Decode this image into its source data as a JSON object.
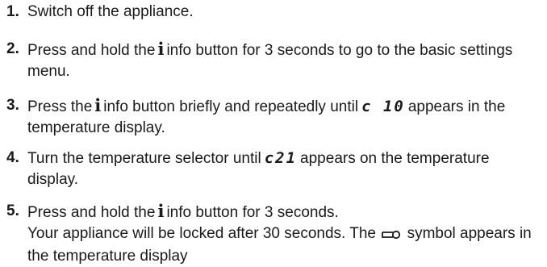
{
  "steps": [
    {
      "number": "1.",
      "text": "Switch off the appliance."
    },
    {
      "number": "2.",
      "pre": "Press and hold the",
      "icon": "i",
      "post": "info button for 3 seconds to go to the basic settings menu."
    },
    {
      "number": "3.",
      "pre": "Press the",
      "icon": "i",
      "mid": "info button briefly and repeatedly until",
      "code": "c 10",
      "post": "appears in the temperature display."
    },
    {
      "number": "4.",
      "pre": "Turn the temperature selector until",
      "code": "c21",
      "post": "appears on the temperature display."
    },
    {
      "number": "5.",
      "pre": "Press and hold the",
      "icon": "i",
      "post": "info button for 3 seconds.",
      "note_pre": "Your appliance will be locked after 30 seconds. The",
      "note_icon": "key-icon",
      "note_post": "symbol appears in the temperature display"
    }
  ]
}
